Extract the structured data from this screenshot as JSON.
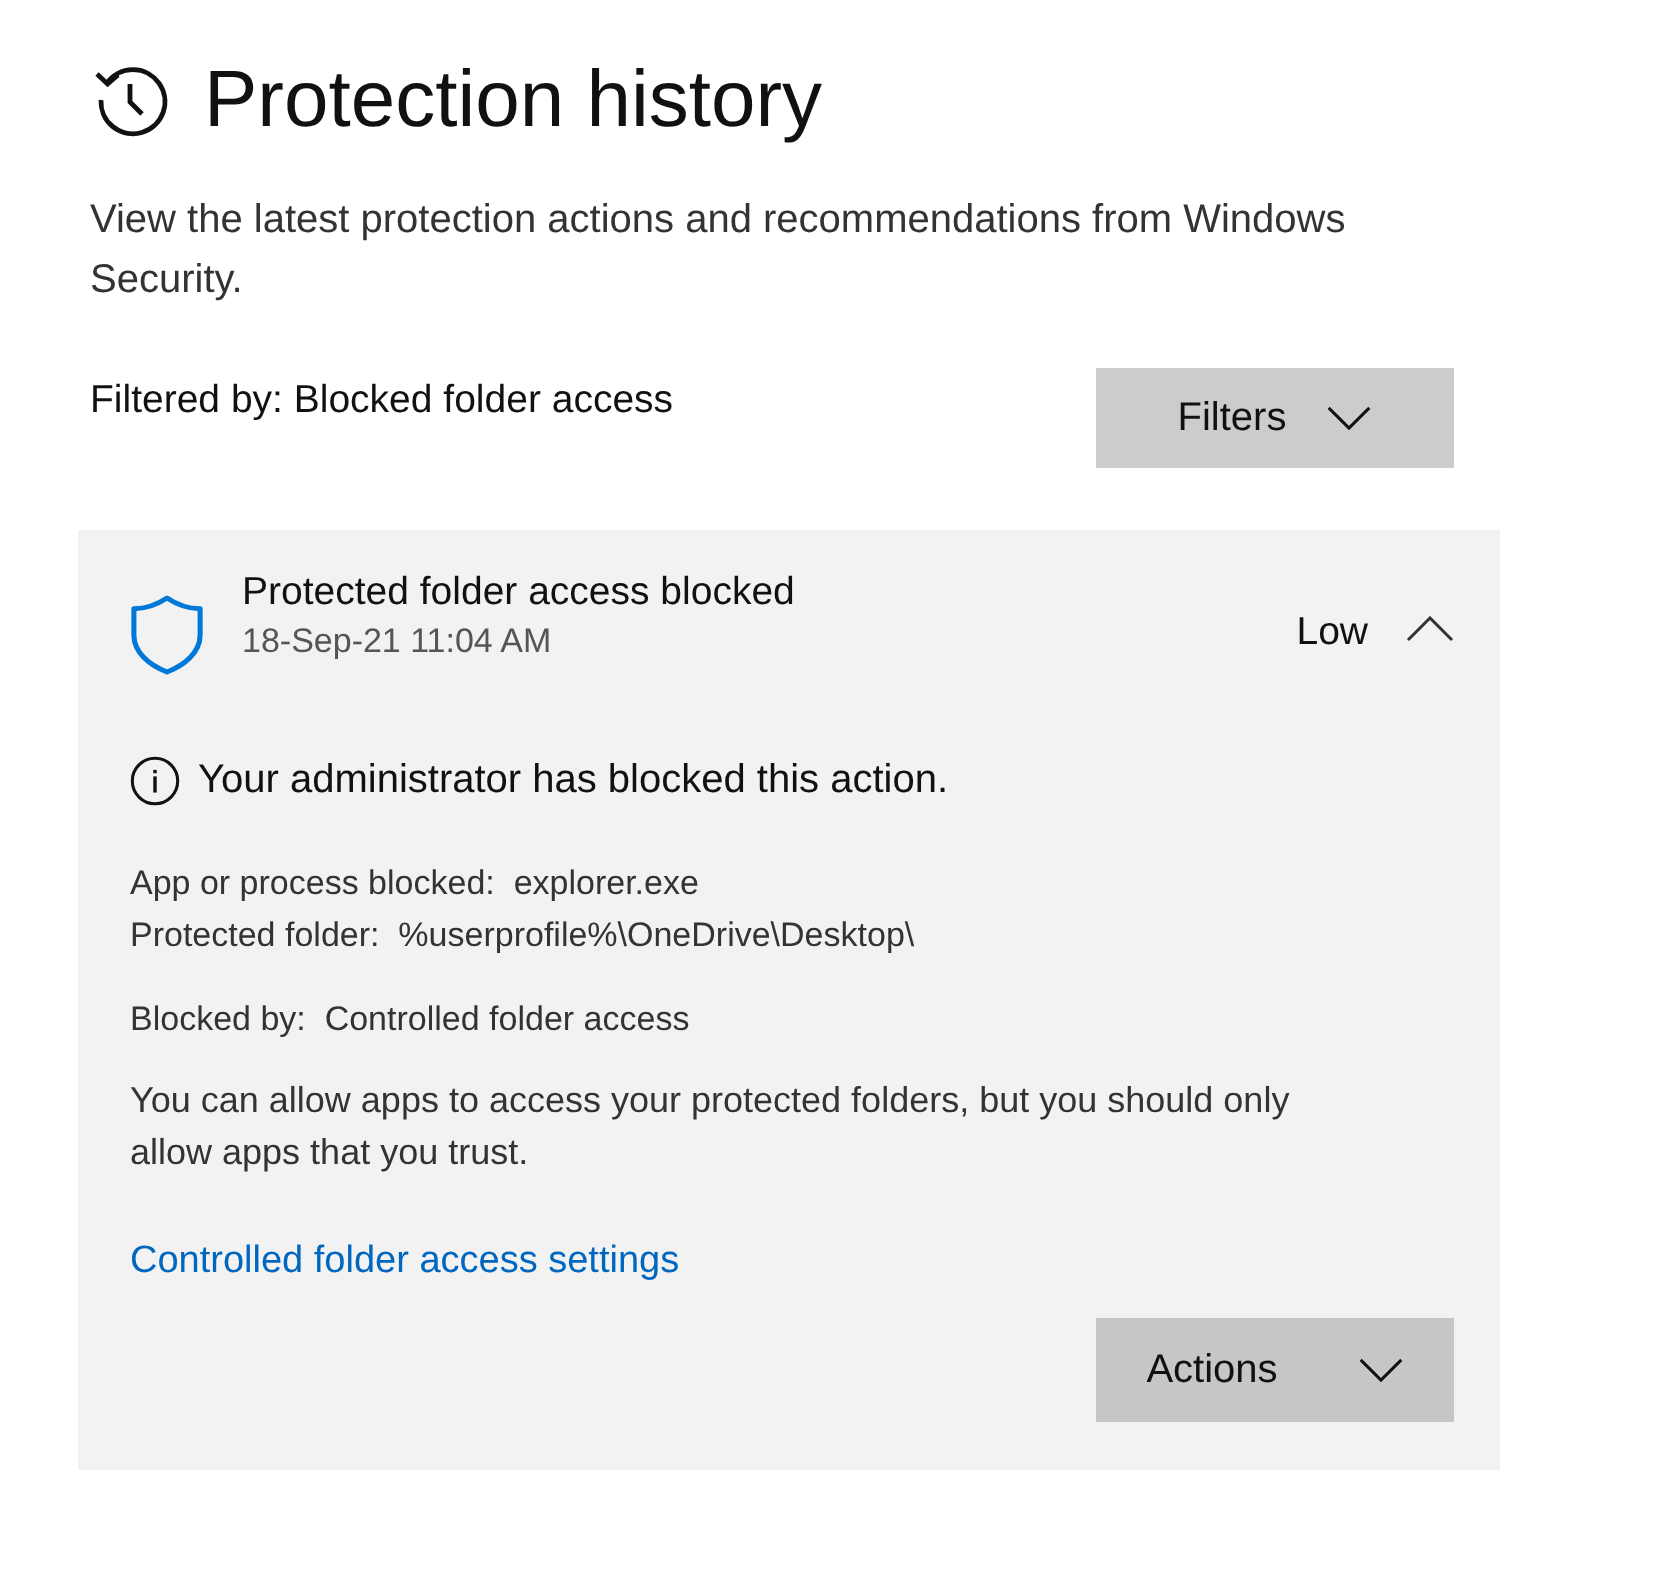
{
  "page": {
    "title": "Protection history",
    "description": "View the latest protection actions and recommendations from Windows Security."
  },
  "filter": {
    "label": "Filtered by: Blocked folder access",
    "button": "Filters"
  },
  "events": [
    {
      "title": "Protected folder access blocked",
      "timestamp": "18-Sep-21 11:04 AM",
      "severity": "Low",
      "expanded": true,
      "notice": "Your administrator has blocked this action.",
      "detail_groups": [
        [
          "App or process blocked:  explorer.exe",
          "Protected folder:  %userprofile%\\OneDrive\\Desktop\\"
        ],
        [
          "Blocked by:  Controlled folder access"
        ]
      ],
      "advice": "You can allow apps to access your protected folders, but you should only allow apps that you trust.",
      "link": "Controlled folder access settings",
      "actions_button": "Actions"
    }
  ]
}
